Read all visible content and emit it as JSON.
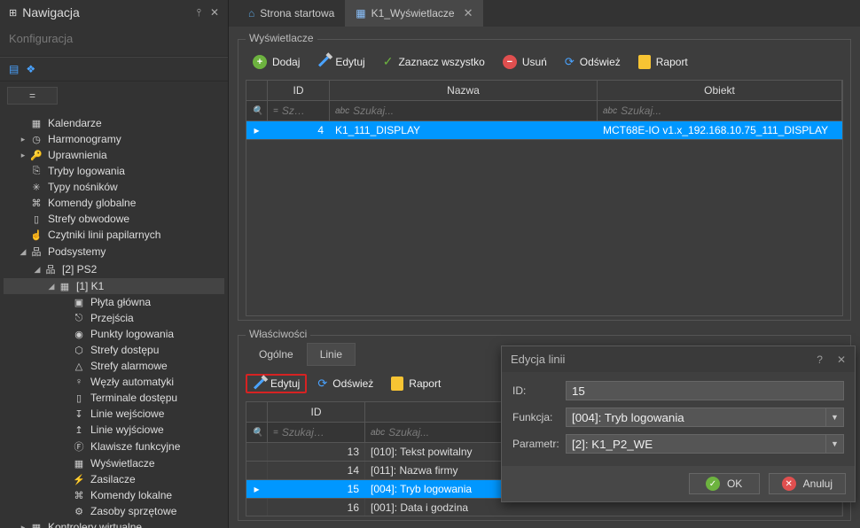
{
  "nav": {
    "title": "Nawigacja",
    "subtitle": "Konfiguracja",
    "eq_label": "="
  },
  "tree": {
    "items": [
      {
        "level": 0,
        "arrow": "",
        "icon": "▦",
        "label": "Kalendarze"
      },
      {
        "level": 0,
        "arrow": "▸",
        "icon": "◷",
        "label": "Harmonogramy"
      },
      {
        "level": 0,
        "arrow": "▸",
        "icon": "🔑",
        "label": "Uprawnienia"
      },
      {
        "level": 0,
        "arrow": "",
        "icon": "⎘",
        "label": "Tryby logowania"
      },
      {
        "level": 0,
        "arrow": "",
        "icon": "✳",
        "label": "Typy nośników"
      },
      {
        "level": 0,
        "arrow": "",
        "icon": "⌘",
        "label": "Komendy globalne"
      },
      {
        "level": 0,
        "arrow": "",
        "icon": "▯",
        "label": "Strefy obwodowe"
      },
      {
        "level": 0,
        "arrow": "",
        "icon": "☝",
        "label": "Czytniki linii papilarnych"
      },
      {
        "level": 0,
        "arrow": "◢",
        "icon": "品",
        "label": "Podsystemy"
      },
      {
        "level": 1,
        "arrow": "◢",
        "icon": "品",
        "label": "[2] PS2"
      },
      {
        "level": 2,
        "arrow": "◢",
        "icon": "▦",
        "label": "[1] K1",
        "selected": true
      },
      {
        "level": 3,
        "arrow": "",
        "icon": "▣",
        "label": "Płyta główna"
      },
      {
        "level": 3,
        "arrow": "",
        "icon": "⎋",
        "label": "Przejścia"
      },
      {
        "level": 3,
        "arrow": "",
        "icon": "◉",
        "label": "Punkty logowania"
      },
      {
        "level": 3,
        "arrow": "",
        "icon": "⬡",
        "label": "Strefy dostępu"
      },
      {
        "level": 3,
        "arrow": "",
        "icon": "△",
        "label": "Strefy alarmowe"
      },
      {
        "level": 3,
        "arrow": "",
        "icon": "♀",
        "label": "Węzły automatyki"
      },
      {
        "level": 3,
        "arrow": "",
        "icon": "▯",
        "label": "Terminale dostępu"
      },
      {
        "level": 3,
        "arrow": "",
        "icon": "↧",
        "label": "Linie wejściowe"
      },
      {
        "level": 3,
        "arrow": "",
        "icon": "↥",
        "label": "Linie wyjściowe"
      },
      {
        "level": 3,
        "arrow": "",
        "icon": "Ⓕ",
        "label": "Klawisze funkcyjne"
      },
      {
        "level": 3,
        "arrow": "",
        "icon": "▦",
        "label": "Wyświetlacze"
      },
      {
        "level": 3,
        "arrow": "",
        "icon": "⚡",
        "label": "Zasilacze"
      },
      {
        "level": 3,
        "arrow": "",
        "icon": "⌘",
        "label": "Komendy lokalne"
      },
      {
        "level": 3,
        "arrow": "",
        "icon": "⚙",
        "label": "Zasoby sprzętowe"
      },
      {
        "level": 0,
        "arrow": "▸",
        "icon": "▦",
        "label": "Kontrolery wirtualne"
      }
    ]
  },
  "tabs": [
    {
      "icon": "⌂",
      "label": "Strona startowa",
      "active": false,
      "closable": false
    },
    {
      "icon": "▦",
      "label": "K1_Wyświetlacze",
      "active": true,
      "closable": true
    }
  ],
  "display_group": {
    "title": "Wyświetlacze",
    "toolbar": {
      "add": "Dodaj",
      "edit": "Edytuj",
      "select_all": "Zaznacz wszystko",
      "delete": "Usuń",
      "refresh": "Odśwież",
      "report": "Raport"
    },
    "headers": {
      "id": "ID",
      "name": "Nazwa",
      "object": "Obiekt"
    },
    "filter_placeholder": {
      "id": "Sz…",
      "name": "Szukaj...",
      "object": "Szukaj..."
    },
    "rows": [
      {
        "id": "4",
        "name": "K1_111_DISPLAY",
        "object": "MCT68E-IO v1.x_192.168.10.75_111_DISPLAY",
        "selected": true
      }
    ]
  },
  "props_group": {
    "title": "Właściwości",
    "tabs": {
      "general": "Ogólne",
      "lines": "Linie"
    },
    "toolbar": {
      "edit": "Edytuj",
      "refresh": "Odśwież",
      "report": "Raport"
    },
    "headers": {
      "id": "ID"
    },
    "filter_placeholder": {
      "id": "Szukaj…",
      "content": "Szukaj..."
    },
    "rows": [
      {
        "id": "13",
        "content": "[010]: Tekst powitalny",
        "selected": false
      },
      {
        "id": "14",
        "content": "[011]: Nazwa firmy",
        "selected": false
      },
      {
        "id": "15",
        "content": "[004]: Tryb logowania",
        "selected": true
      },
      {
        "id": "16",
        "content": "[001]: Data i godzina",
        "selected": false
      }
    ]
  },
  "dialog": {
    "title": "Edycja linii",
    "fields": {
      "id": {
        "label": "ID:",
        "value": "15"
      },
      "func": {
        "label": "Funkcja:",
        "value": "[004]: Tryb logowania"
      },
      "param": {
        "label": "Parametr:",
        "value": "[2]: K1_P2_WE"
      }
    },
    "buttons": {
      "ok": "OK",
      "cancel": "Anuluj"
    }
  }
}
